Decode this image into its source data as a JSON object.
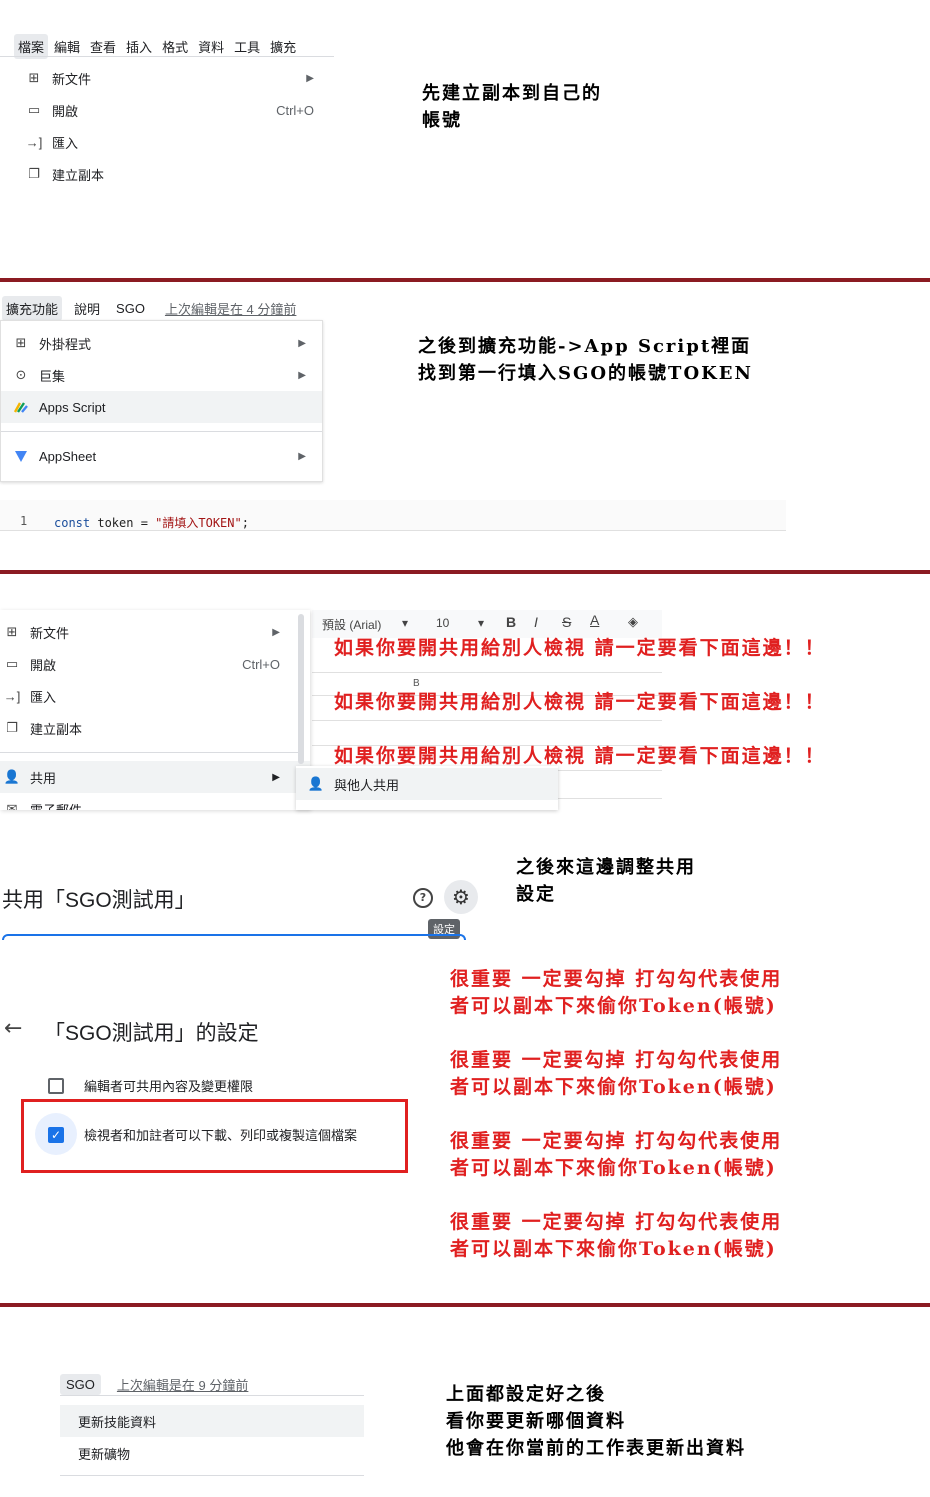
{
  "section1": {
    "menubar": [
      "檔案",
      "編輯",
      "查看",
      "插入",
      "格式",
      "資料",
      "工具",
      "擴充"
    ],
    "menu": [
      {
        "label": "新文件",
        "shortcut": "",
        "submenu": true
      },
      {
        "label": "開啟",
        "shortcut": "Ctrl+O",
        "submenu": false
      },
      {
        "label": "匯入",
        "shortcut": "",
        "submenu": false
      },
      {
        "label": "建立副本",
        "shortcut": "",
        "submenu": false
      }
    ],
    "note": [
      "先建立副本到自己的",
      "帳號"
    ]
  },
  "section2": {
    "menubar": [
      "擴充功能",
      "說明",
      "SGO"
    ],
    "last_edit": "上次編輯是在 4 分鐘前",
    "menu": [
      {
        "label": "外掛程式"
      },
      {
        "label": "巨集"
      },
      {
        "label": "Apps Script"
      },
      {
        "label": "AppSheet"
      }
    ],
    "code": {
      "line": "1",
      "keyword": "const",
      "rest": " token = ",
      "string": "\"請填入TOKEN\"",
      "end": ";"
    },
    "note": [
      "之後到擴充功能->App Script裡面",
      "找到第一行填入SGO的帳號TOKEN"
    ]
  },
  "section3": {
    "menu": [
      {
        "label": "新文件",
        "shortcut": ""
      },
      {
        "label": "開啟",
        "shortcut": "Ctrl+O"
      },
      {
        "label": "匯入",
        "shortcut": ""
      },
      {
        "label": "建立副本",
        "shortcut": ""
      },
      {
        "label": "共用",
        "shortcut": ""
      },
      {
        "label": "電子郵件",
        "shortcut": ""
      }
    ],
    "submenu": [
      {
        "label": "與他人共用"
      }
    ],
    "toolbar": {
      "font": "預設 (Arial)",
      "size": "10",
      "column": "B"
    },
    "warning": "如果你要開共用給別人檢視 請一定要看下面這邊！！"
  },
  "section4": {
    "dialog_title": "共用「SGO測試用」",
    "tooltip": "設定",
    "settings_title": "「SGO測試用」的設定",
    "option1": "編輯者可共用內容及變更權限",
    "option2": "檢視者和加註者可以下載、列印或複製這個檔案",
    "note": [
      "之後來這邊調整共用",
      "設定"
    ],
    "warning": [
      "很重要 一定要勾掉 打勾勾代表使用",
      "者可以副本下來偷你Token(帳號)"
    ]
  },
  "section5": {
    "menubar_item": "SGO",
    "last_edit": "上次編輯是在 9 分鐘前",
    "menu": [
      {
        "label": "更新技能資料"
      },
      {
        "label": "更新礦物"
      }
    ],
    "note": [
      "上面都設定好之後",
      "看你要更新哪個資料",
      "他會在你當前的工作表更新出資料"
    ]
  },
  "colors": {
    "divider": "#8b1b22",
    "warning": "#e02020",
    "highlight_box": "#e02020",
    "checkbox": "#1a73e8"
  }
}
